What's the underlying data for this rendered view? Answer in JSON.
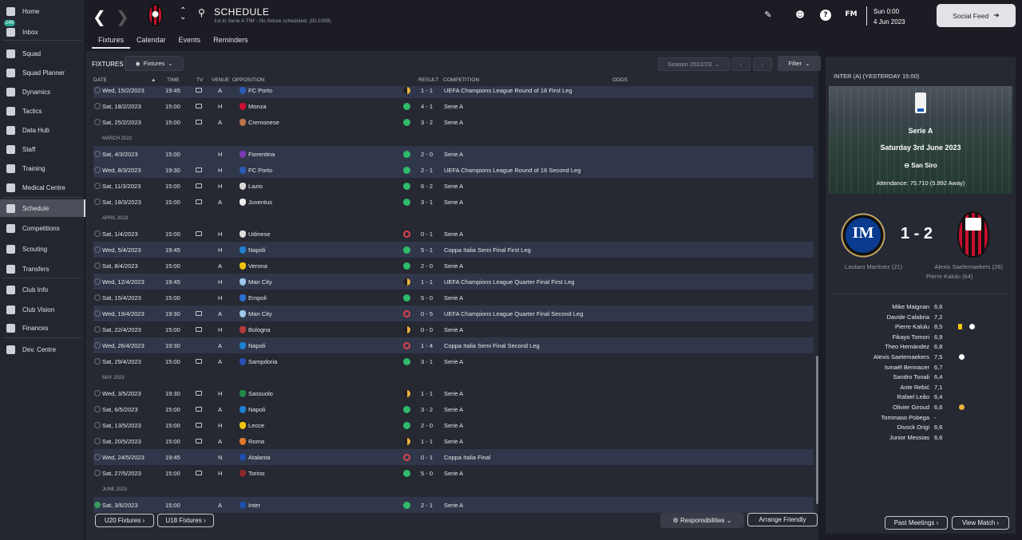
{
  "sidebar": {
    "items": [
      {
        "label": "Home",
        "icon": "home-icon"
      },
      {
        "label": "Inbox",
        "icon": "inbox-icon",
        "badge": "149"
      },
      {
        "label": "Squad",
        "icon": "shirt-icon"
      },
      {
        "label": "Squad Planner",
        "icon": "planner-icon"
      },
      {
        "label": "Dynamics",
        "icon": "dynamics-icon"
      },
      {
        "label": "Tactics",
        "icon": "tactics-icon"
      },
      {
        "label": "Data Hub",
        "icon": "data-hub-icon"
      },
      {
        "label": "Staff",
        "icon": "staff-icon"
      },
      {
        "label": "Training",
        "icon": "training-icon"
      },
      {
        "label": "Medical Centre",
        "icon": "medical-icon"
      },
      {
        "label": "Schedule",
        "icon": "calendar-icon",
        "active": true
      },
      {
        "label": "Competitions",
        "icon": "trophy-icon"
      },
      {
        "label": "Scouting",
        "icon": "scouting-icon"
      },
      {
        "label": "Transfers",
        "icon": "transfers-icon"
      },
      {
        "label": "Club Info",
        "icon": "shield-icon"
      },
      {
        "label": "Club Vision",
        "icon": "vision-icon"
      },
      {
        "label": "Finances",
        "icon": "finances-icon"
      },
      {
        "label": "Dev. Centre",
        "icon": "dev-centre-icon"
      }
    ]
  },
  "header": {
    "title": "SCHEDULE",
    "subtitle": "1st in Serie A TIM - No fixture scheduled. (ID:1099)",
    "day_time": "Sun 0:00",
    "date": "4 Jun 2023",
    "social_feed": "Social Feed",
    "fm": "FM"
  },
  "tabs": [
    "Fixtures",
    "Calendar",
    "Events",
    "Reminders"
  ],
  "fixtures": {
    "label": "FIXTURES",
    "dropdown": "Fixtures",
    "season": "Season 2022/23",
    "filter": "Filter",
    "columns": {
      "date": "DATE",
      "time": "TIME",
      "tv": "TV",
      "venue": "VENUE",
      "opposition": "OPPOSITION",
      "result": "RESULT",
      "competition": "COMPETITION",
      "odds": "ODDS"
    },
    "rows": [
      {
        "date": "Wed, 15/2/2023",
        "time": "19:45",
        "tv": true,
        "venue": "A",
        "opp": "FC Porto",
        "res": "d",
        "score": "1 - 1",
        "comp": "UEFA Champions League Round of 16 First Leg",
        "hl": true,
        "badge": "#2a5cb3"
      },
      {
        "date": "Sat, 18/2/2023",
        "time": "15:00",
        "tv": true,
        "venue": "H",
        "opp": "Monza",
        "res": "w",
        "score": "4 - 1",
        "comp": "Serie A",
        "badge": "#c8102e"
      },
      {
        "date": "Sat, 25/2/2023",
        "time": "15:00",
        "tv": true,
        "venue": "A",
        "opp": "Cremonese",
        "res": "w",
        "score": "3 - 2",
        "comp": "Serie A",
        "badge": "#b8734a"
      },
      {
        "month": "MARCH 2023"
      },
      {
        "date": "Sat, 4/3/2023",
        "time": "15:00",
        "tv": false,
        "venue": "H",
        "opp": "Fiorentina",
        "res": "w",
        "score": "2 - 0",
        "comp": "Serie A",
        "hl": true,
        "badge": "#7a3bb3"
      },
      {
        "date": "Wed, 8/3/2023",
        "time": "19:30",
        "tv": true,
        "venue": "H",
        "opp": "FC Porto",
        "res": "w",
        "score": "2 - 1",
        "comp": "UEFA Champions League Round of 16 Second Leg",
        "hl": true,
        "badge": "#2a5cb3"
      },
      {
        "date": "Sat, 11/3/2023",
        "time": "15:00",
        "tv": true,
        "venue": "H",
        "opp": "Lazio",
        "res": "w",
        "score": "6 - 2",
        "comp": "Serie A",
        "badge": "#d9d9d9"
      },
      {
        "date": "Sat, 18/3/2023",
        "time": "15:00",
        "tv": true,
        "venue": "A",
        "opp": "Juventus",
        "res": "w",
        "score": "3 - 1",
        "comp": "Serie A",
        "badge": "#eeeeee"
      },
      {
        "month": "APRIL 2023"
      },
      {
        "date": "Sat, 1/4/2023",
        "time": "15:00",
        "tv": true,
        "venue": "H",
        "opp": "Udinese",
        "res": "l",
        "score": "0 - 1",
        "comp": "Serie A",
        "badge": "#dddddd"
      },
      {
        "date": "Wed, 5/4/2023",
        "time": "19:45",
        "tv": false,
        "venue": "H",
        "opp": "Napoli",
        "res": "w",
        "score": "5 - 1",
        "comp": "Coppa Italia Semi Final First Leg",
        "hl": true,
        "badge": "#1f7fd1"
      },
      {
        "date": "Sat, 8/4/2023",
        "time": "15:00",
        "tv": false,
        "venue": "A",
        "opp": "Verona",
        "res": "w",
        "score": "2 - 0",
        "comp": "Serie A",
        "badge": "#f1c40f"
      },
      {
        "date": "Wed, 12/4/2023",
        "time": "19:45",
        "tv": false,
        "venue": "H",
        "opp": "Man City",
        "res": "d",
        "score": "1 - 1",
        "comp": "UEFA Champions League Quarter Final First Leg",
        "hl": true,
        "badge": "#9ec7ea"
      },
      {
        "date": "Sat, 15/4/2023",
        "time": "15:00",
        "tv": false,
        "venue": "H",
        "opp": "Empoli",
        "res": "w",
        "score": "5 - 0",
        "comp": "Serie A",
        "badge": "#2a6fd1"
      },
      {
        "date": "Wed, 19/4/2023",
        "time": "19:30",
        "tv": true,
        "venue": "A",
        "opp": "Man City",
        "res": "l",
        "score": "0 - 5",
        "comp": "UEFA Champions League Quarter Final Second Leg",
        "hl": true,
        "badge": "#9ec7ea"
      },
      {
        "date": "Sat, 22/4/2023",
        "time": "15:00",
        "tv": true,
        "venue": "H",
        "opp": "Bologna",
        "res": "d",
        "score": "0 - 0",
        "comp": "Serie A",
        "badge": "#b53a3a"
      },
      {
        "date": "Wed, 26/4/2023",
        "time": "19:30",
        "tv": false,
        "venue": "A",
        "opp": "Napoli",
        "res": "l",
        "score": "1 - 4",
        "comp": "Coppa Italia Semi Final Second Leg",
        "hl": true,
        "badge": "#1f7fd1"
      },
      {
        "date": "Sat, 29/4/2023",
        "time": "15:00",
        "tv": true,
        "venue": "A",
        "opp": "Sampdoria",
        "res": "w",
        "score": "3 - 1",
        "comp": "Serie A",
        "badge": "#2a4fb3"
      },
      {
        "month": "MAY 2023"
      },
      {
        "date": "Wed, 3/5/2023",
        "time": "19:30",
        "tv": true,
        "venue": "H",
        "opp": "Sassuolo",
        "res": "d",
        "score": "1 - 1",
        "comp": "Serie A",
        "badge": "#1f8a4a"
      },
      {
        "date": "Sat, 6/5/2023",
        "time": "15:00",
        "tv": true,
        "venue": "A",
        "opp": "Napoli",
        "res": "w",
        "score": "3 - 2",
        "comp": "Serie A",
        "badge": "#1f7fd1"
      },
      {
        "date": "Sat, 13/5/2023",
        "time": "15:00",
        "tv": true,
        "venue": "H",
        "opp": "Lecce",
        "res": "w",
        "score": "2 - 0",
        "comp": "Serie A",
        "badge": "#f1c40f"
      },
      {
        "date": "Sat, 20/5/2023",
        "time": "15:00",
        "tv": true,
        "venue": "A",
        "opp": "Roma",
        "res": "d",
        "score": "1 - 1",
        "comp": "Serie A",
        "badge": "#e07a2a"
      },
      {
        "date": "Wed, 24/5/2023",
        "time": "19:45",
        "tv": false,
        "venue": "N",
        "opp": "Atalanta",
        "res": "l",
        "score": "0 - 1",
        "comp": "Coppa Italia Final",
        "hl": true,
        "badge": "#1f4fa8"
      },
      {
        "date": "Sat, 27/5/2023",
        "time": "15:00",
        "tv": true,
        "venue": "H",
        "opp": "Torino",
        "res": "w",
        "score": "5 - 0",
        "comp": "Serie A",
        "badge": "#8a2a2a"
      },
      {
        "month": "JUNE 2023"
      },
      {
        "date": "Sat, 3/6/2023",
        "time": "15:00",
        "tv": false,
        "venue": "A",
        "opp": "Inter",
        "res": "w",
        "score": "2 - 1",
        "comp": "Serie A",
        "hl": true,
        "done": true,
        "badge": "#1f4fa8"
      }
    ]
  },
  "bottom": {
    "u20": "U20 Fixtures",
    "u18": "U18 Fixtures",
    "responsibilities": "Responsibilities",
    "arrange": "Arrange Friendly"
  },
  "match": {
    "heading": "INTER (A) (YESTERDAY 15:00)",
    "competition": "Serie A",
    "date": "Saturday 3rd June 2023",
    "venue": "San Siro",
    "attendance": "Attendance: 75.710 (5.992 Away)",
    "score": "1 - 2",
    "home_scorers": [
      "Lautaro Martínez (21)"
    ],
    "away_scorers": [
      "Alexis Saelemaekers (26)",
      "Pierre Kalulu (64)"
    ],
    "players": [
      {
        "name": "Mike Maignan",
        "rating": "6,6"
      },
      {
        "name": "Davide Calabria",
        "rating": "7,2"
      },
      {
        "name": "Pierre Kalulu",
        "rating": "8,5",
        "card": true,
        "goal": true
      },
      {
        "name": "Fikayo Tomori",
        "rating": "6,9"
      },
      {
        "name": "Theo Hernández",
        "rating": "6,8"
      },
      {
        "name": "Alexis Saelemaekers",
        "rating": "7,5",
        "goal": true
      },
      {
        "name": "Ismaël Bennacer",
        "rating": "6,7"
      },
      {
        "name": "Sandro Tonali",
        "rating": "6,4"
      },
      {
        "name": "Ante Rebić",
        "rating": "7,1"
      },
      {
        "name": "Rafael Leão",
        "rating": "6,4"
      },
      {
        "name": "Olivier Giroud",
        "rating": "6,6",
        "subbed": true
      },
      {
        "name": "Tommaso Pobega",
        "rating": "-"
      },
      {
        "name": "Divock Origi",
        "rating": "6,6"
      },
      {
        "name": "Junior Messias",
        "rating": "6,6"
      }
    ],
    "past": "Past Meetings",
    "view": "View Match"
  }
}
